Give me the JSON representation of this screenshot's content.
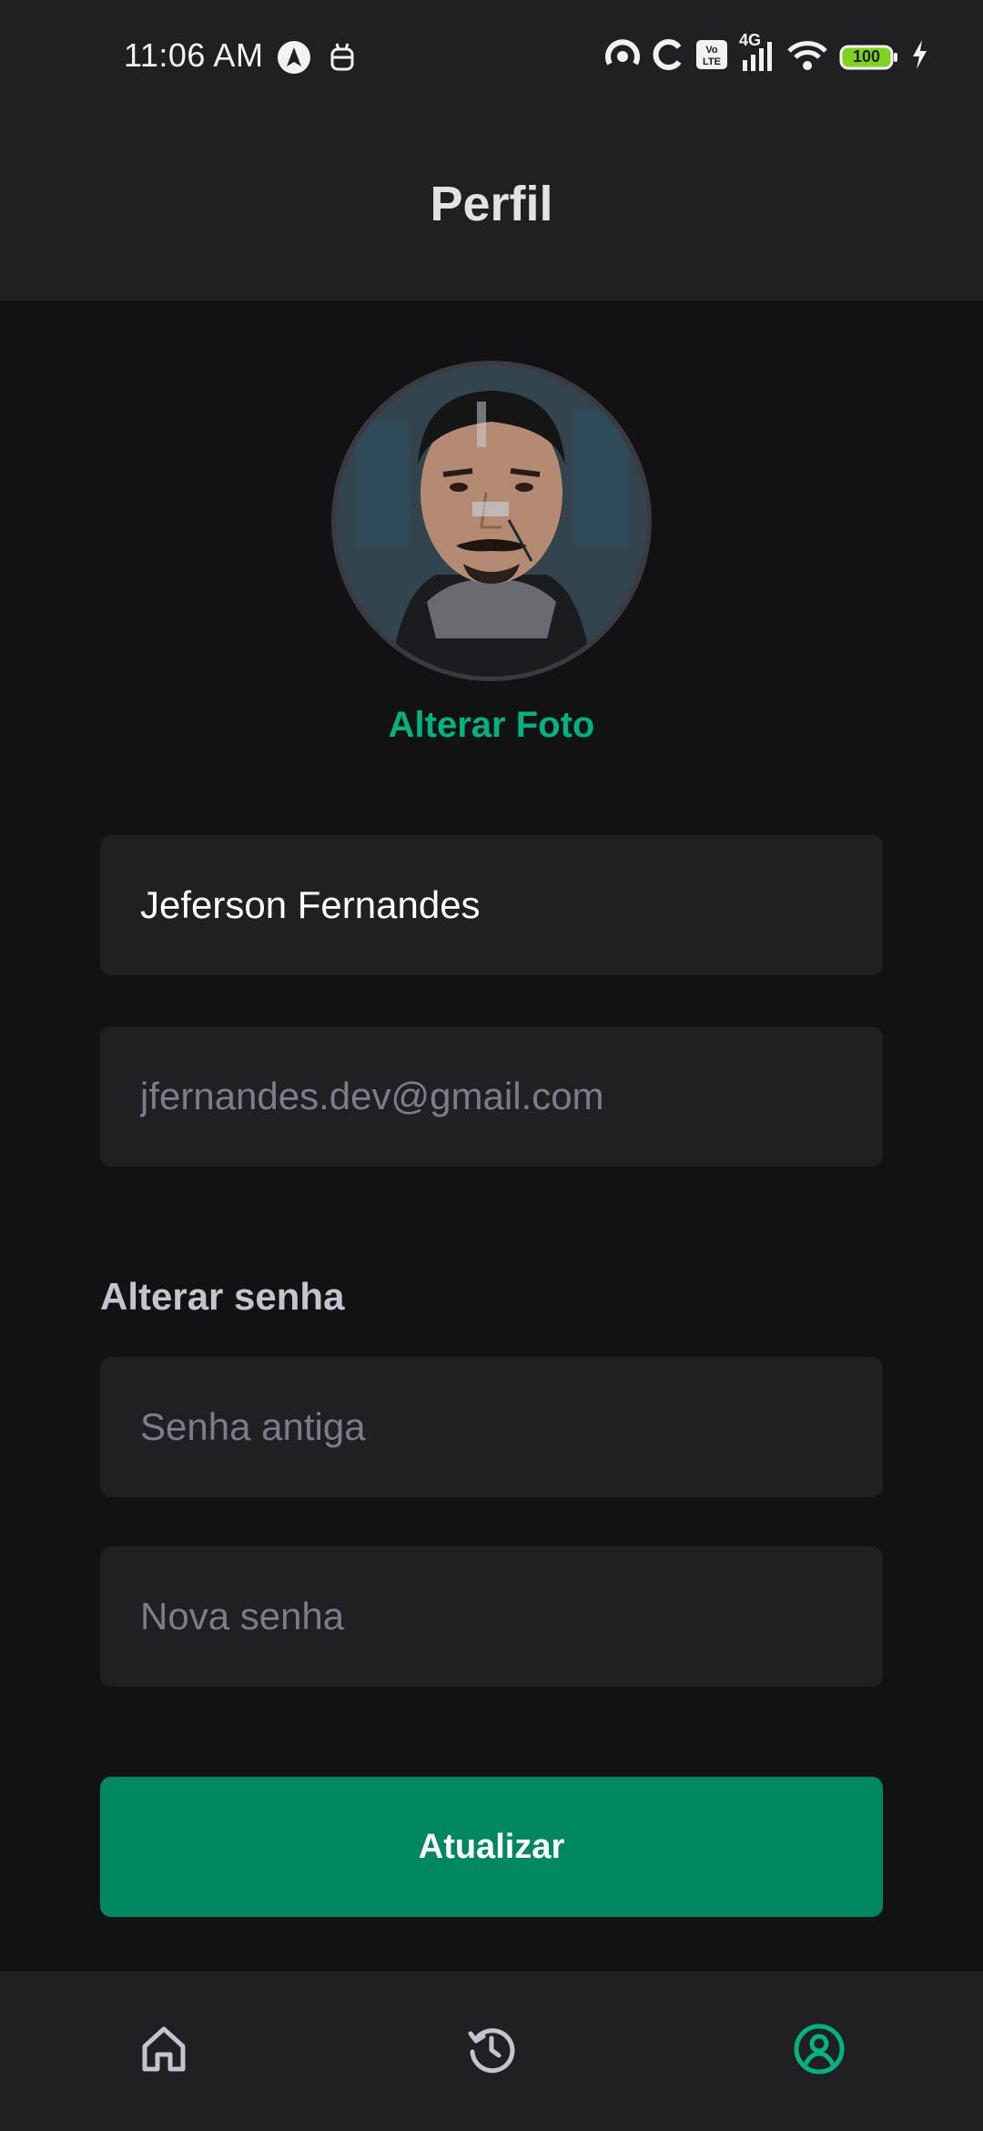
{
  "status_bar": {
    "time": "11:06 AM",
    "battery": "100",
    "network": "4G",
    "icons": [
      "navigation-icon",
      "android-icon",
      "hotspot-icon",
      "sync-icon",
      "volte-icon",
      "signal-icon",
      "wifi-icon",
      "battery-icon",
      "charging-icon"
    ]
  },
  "header": {
    "title": "Perfil"
  },
  "profile": {
    "avatar": "user-avatar",
    "change_photo_label": "Alterar Foto"
  },
  "form": {
    "name_value": "Jeferson Fernandes",
    "email_value": "jfernandes.dev@gmail.com",
    "password_section_label": "Alterar senha",
    "old_password_placeholder": "Senha antiga",
    "new_password_placeholder": "Nova senha",
    "submit_label": "Atualizar"
  },
  "bottom_nav": {
    "items": [
      {
        "icon": "home-icon",
        "active": false
      },
      {
        "icon": "history-icon",
        "active": false
      },
      {
        "icon": "profile-icon",
        "active": true
      }
    ]
  },
  "colors": {
    "background": "#121214",
    "surface": "#202024",
    "accent": "#00B37E",
    "button": "#00875F",
    "placeholder": "#7C7C8A"
  }
}
